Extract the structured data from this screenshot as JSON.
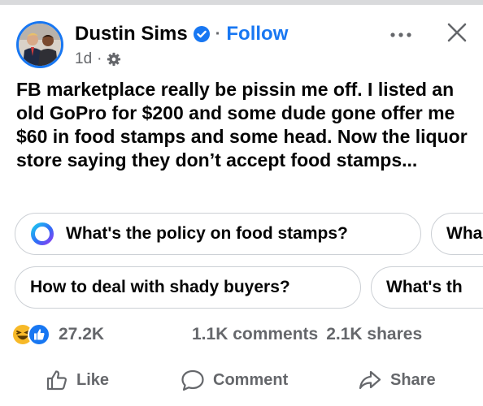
{
  "post": {
    "author": "Dustin Sims",
    "separator": "·",
    "follow_label": "Follow",
    "time": "1d",
    "meta_separator": "·",
    "text": "FB marketplace really be pissin me off. I listed an old GoPro for $200 and some dude gone offer me $60 in food stamps and some head. Now the liquor store saying they don’t accept food stamps..."
  },
  "icons": {
    "verified": "verified-badge-icon",
    "audience": "gear-audience-icon",
    "more": "more-options-icon",
    "close": "close-icon",
    "ai_prompt": "meta-ai-ring-icon",
    "reactions": [
      "haha-reaction-icon",
      "like-reaction-icon"
    ],
    "like": "thumbs-up-icon",
    "comment": "comment-bubble-icon",
    "share": "share-arrow-icon"
  },
  "suggestions": {
    "row1": [
      "What's the policy on food stamps?",
      "Wha"
    ],
    "row2": [
      "How to deal with shady buyers?",
      "What's th"
    ]
  },
  "stats": {
    "reactions": "27.2K",
    "comments": "1.1K comments",
    "shares": "2.1K shares"
  },
  "actions": {
    "like": "Like",
    "comment": "Comment",
    "share": "Share"
  },
  "colors": {
    "accent": "#1877f2",
    "muted_text": "#65676b",
    "chip_border": "#ccd0d5",
    "haha_yellow": "#f7b928"
  }
}
